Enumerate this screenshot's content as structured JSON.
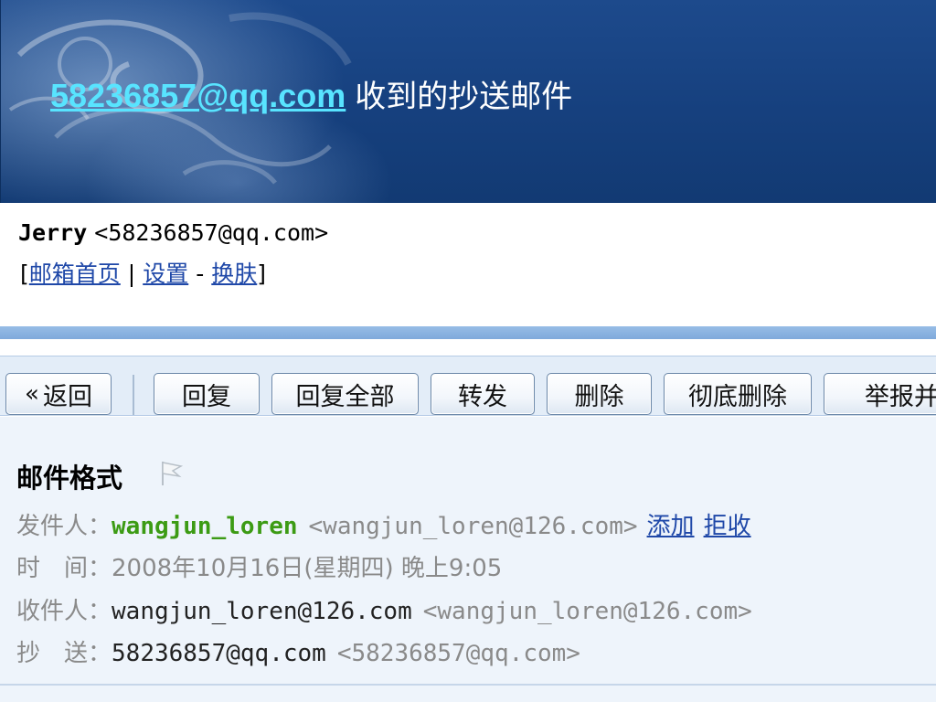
{
  "banner": {
    "address_link": "58236857@qq.com",
    "title_text": "收到的抄送邮件"
  },
  "account": {
    "name": "Jerry",
    "email": "<58236857@qq.com>",
    "links": {
      "open_bracket": "[",
      "home": "邮箱首页",
      "bar": "|",
      "settings": "设置",
      "dash": "-",
      "skin": "换肤",
      "close_bracket": "]"
    }
  },
  "toolbar": {
    "back_chevron": "«",
    "back_label": "返回",
    "reply_label": "回复",
    "reply_all_label": "回复全部",
    "forward_label": "转发",
    "delete_label": "删除",
    "purge_label": "彻底删除",
    "report_label": "举报并"
  },
  "mail": {
    "subject": "邮件格式",
    "from": {
      "label": "发件人：",
      "name": "wangjun_loren",
      "email": "<wangjun_loren@126.com>",
      "add_link": "添加",
      "reject_link": "拒收"
    },
    "time": {
      "label": "时　间：",
      "value": "2008年10月16日(星期四) 晚上9:05"
    },
    "to": {
      "label": "收件人：",
      "name": "wangjun_loren@126.com",
      "email": "<wangjun_loren@126.com>"
    },
    "cc": {
      "label": "抄　送：",
      "name": "58236857@qq.com",
      "email": "<58236857@qq.com>"
    }
  },
  "colors": {
    "banner_blue": "#16407e",
    "link_cyan": "#58e4ff",
    "link_blue": "#1f48a8",
    "sender_green": "#3c9b14",
    "label_grey": "#8a8a8a"
  },
  "icons": {
    "flag": "flag-icon"
  }
}
